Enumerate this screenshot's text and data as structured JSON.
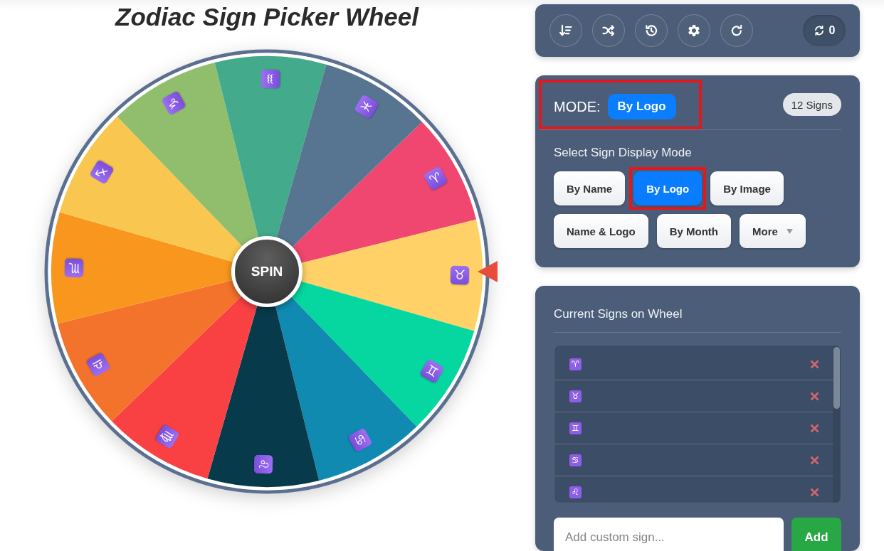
{
  "page_title": "Zodiac Sign Picker Wheel",
  "wheel": {
    "spin_label": "SPIN",
    "segments": [
      {
        "symbol": "♈",
        "color": "#ef476f"
      },
      {
        "symbol": "♉",
        "color": "#ffd166"
      },
      {
        "symbol": "♊",
        "color": "#06d6a0"
      },
      {
        "symbol": "♋",
        "color": "#118ab2"
      },
      {
        "symbol": "♌",
        "color": "#073b4c"
      },
      {
        "symbol": "♍",
        "color": "#f94144"
      },
      {
        "symbol": "♎",
        "color": "#f3722c"
      },
      {
        "symbol": "♏",
        "color": "#f8961e"
      },
      {
        "symbol": "♐",
        "color": "#f9c74f"
      },
      {
        "symbol": "♑",
        "color": "#90be6d"
      },
      {
        "symbol": "♒",
        "color": "#43aa8b"
      },
      {
        "symbol": "♓",
        "color": "#577590"
      }
    ]
  },
  "toolbar": {
    "spin_counter": "0"
  },
  "mode_panel": {
    "mode": {
      "label": "MODE:",
      "value": "By Logo",
      "highlighted": true
    },
    "sign_count": "12 Signs",
    "heading": "Select Sign Display Mode",
    "options": [
      {
        "label": "By Name",
        "kind": "option",
        "selected": false,
        "highlighted": false
      },
      {
        "label": "By Logo",
        "kind": "option",
        "selected": true,
        "highlighted": true
      },
      {
        "label": "By Image",
        "kind": "option",
        "selected": false,
        "highlighted": false
      },
      {
        "label": "Name & Logo",
        "kind": "option",
        "selected": false,
        "highlighted": false
      },
      {
        "label": "By Month",
        "kind": "option",
        "selected": false,
        "highlighted": false
      },
      {
        "label": "More",
        "kind": "dropdown",
        "selected": false,
        "highlighted": false
      }
    ]
  },
  "signs_panel": {
    "heading": "Current Signs on Wheel",
    "items": [
      {
        "symbol": "♈"
      },
      {
        "symbol": "♉"
      },
      {
        "symbol": "♊"
      },
      {
        "symbol": "♋"
      },
      {
        "symbol": "♌"
      }
    ],
    "input": {
      "placeholder": "Add custom sign..."
    },
    "add_button": "Add"
  }
}
